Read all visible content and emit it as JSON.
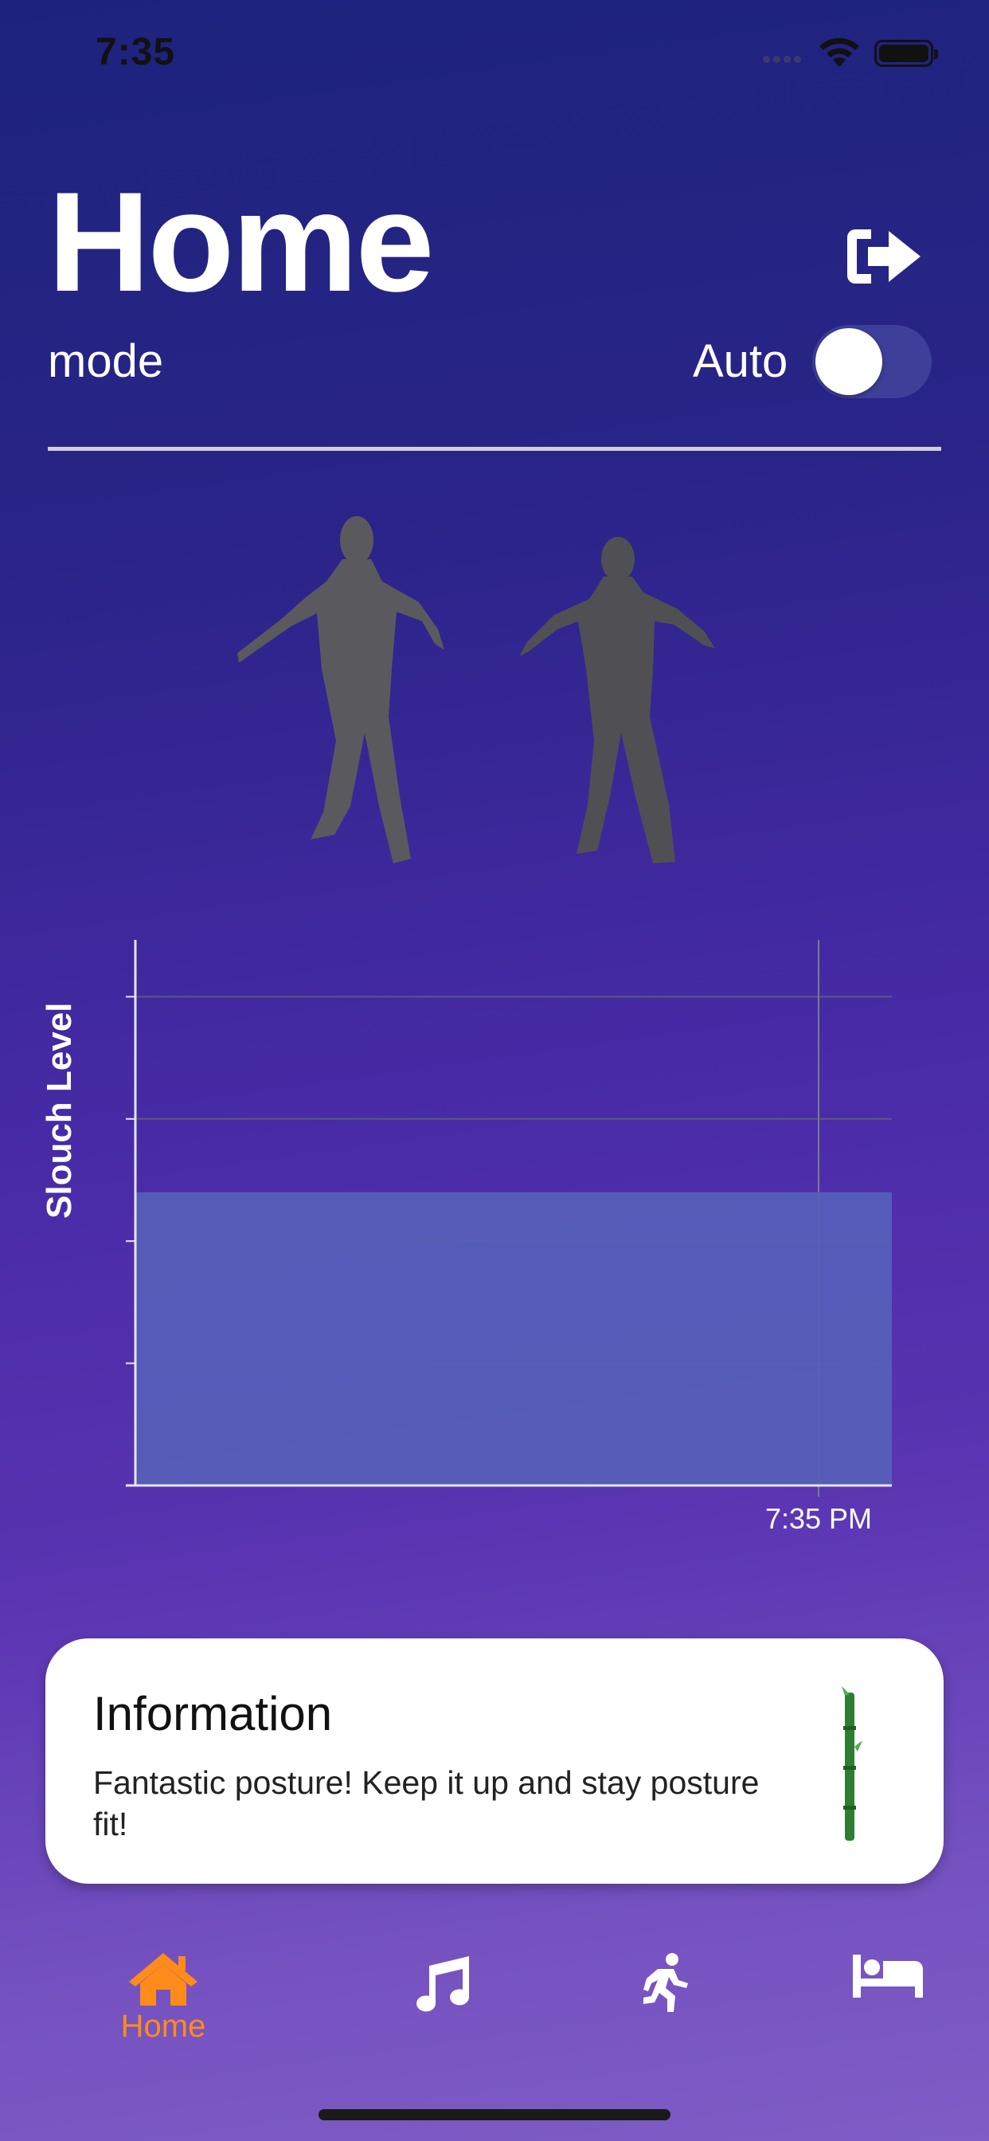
{
  "status_bar": {
    "time": "7:35"
  },
  "header": {
    "title": "Home",
    "mode_label": "mode",
    "auto_label": "Auto",
    "auto_toggle_on": false
  },
  "chart": {
    "ylabel": "Slouch Level",
    "time_label": "7:35 PM"
  },
  "chart_data": {
    "type": "area",
    "ylabel": "Slouch Level",
    "x": [
      "7:35 PM"
    ],
    "series": [
      {
        "values": [
          2.4
        ]
      }
    ],
    "ylim": [
      0,
      4.4
    ],
    "grid": true,
    "fill_color": "#5660b8"
  },
  "info_card": {
    "title": "Information",
    "body": "Fantastic posture! Keep it up and stay posture fit!"
  },
  "tabs": [
    {
      "label": "Home",
      "icon": "home-icon",
      "active": true
    },
    {
      "label": "",
      "icon": "music-icon",
      "active": false
    },
    {
      "label": "",
      "icon": "running-icon",
      "active": false
    },
    {
      "label": "",
      "icon": "bed-icon",
      "active": false
    }
  ],
  "colors": {
    "accent": "#ff8c1a",
    "card_bg": "#ffffff"
  }
}
